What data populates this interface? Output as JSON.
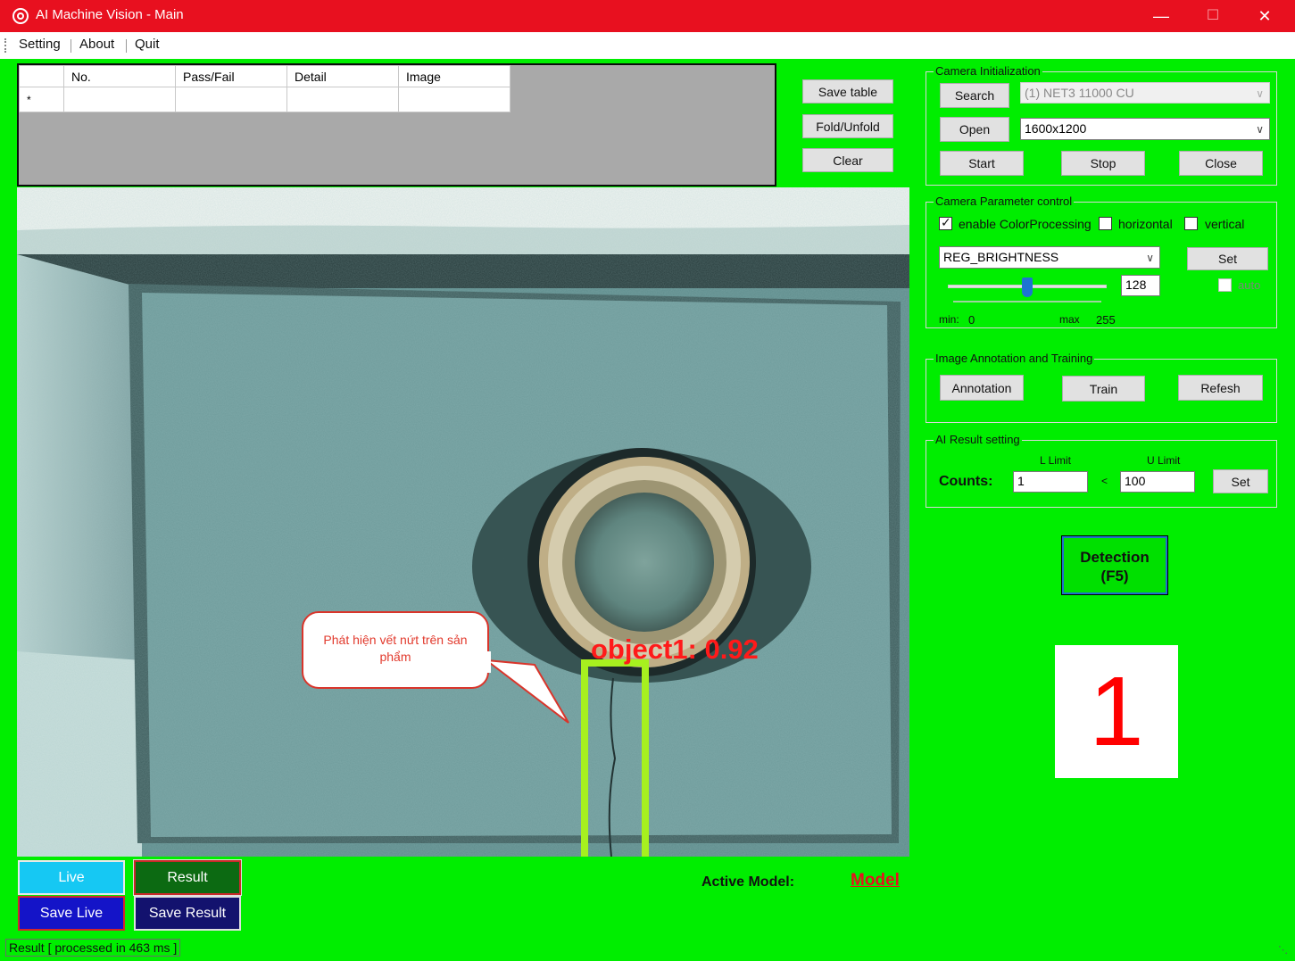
{
  "window": {
    "title": "AI Machine Vision - Main",
    "minimize": "—",
    "maximize": "☐",
    "close": "✕"
  },
  "menu": [
    "Setting",
    "About",
    "Quit"
  ],
  "grid": {
    "columns": [
      "No.",
      "Pass/Fail",
      "Detail",
      "Image"
    ],
    "new_row_marker": "*"
  },
  "grid_buttons": {
    "save_table": "Save table",
    "fold_unfold": "Fold/Unfold",
    "clear": "Clear"
  },
  "image": {
    "detection_label": "object1: 0.92",
    "callout_text": "Phát hiện vết nứt trên sản phẩm"
  },
  "camera_init": {
    "title": "Camera Initialization",
    "search": "Search",
    "open": "Open",
    "start": "Start",
    "stop": "Stop",
    "close": "Close",
    "device": "(1) NET3 11000 CU",
    "resolution": "1600x1200"
  },
  "camera_param": {
    "title": "Camera Parameter control",
    "enable_color": "enable ColorProcessing",
    "enable_color_checked": true,
    "horizontal": "horizontal",
    "vertical": "vertical",
    "parameter": "REG_BRIGHTNESS",
    "set": "Set",
    "value": "128",
    "auto": "auto",
    "min_label": "min:",
    "min_value": "0",
    "max_label": "max",
    "max_value": "255",
    "slider_fraction": 0.5
  },
  "annotation": {
    "title": "Image Annotation and Training",
    "annotation": "Annotation",
    "train": "Train",
    "refresh": "Refesh"
  },
  "ai_result": {
    "title": "AI Result setting",
    "l_limit_label": "L Limit",
    "u_limit_label": "U Limit",
    "counts_label": "Counts:",
    "l_limit": "1",
    "lt": "<",
    "u_limit": "100",
    "set": "Set"
  },
  "detection": {
    "line1": "Detection",
    "line2": "(F5)"
  },
  "result_count": "1",
  "bottom": {
    "live": "Live",
    "result": "Result",
    "save_live": "Save Live",
    "save_result": "Save Result",
    "active_model_label": "Active Model:",
    "model": "Model"
  },
  "status": "Result [ processed in 463 ms ]"
}
